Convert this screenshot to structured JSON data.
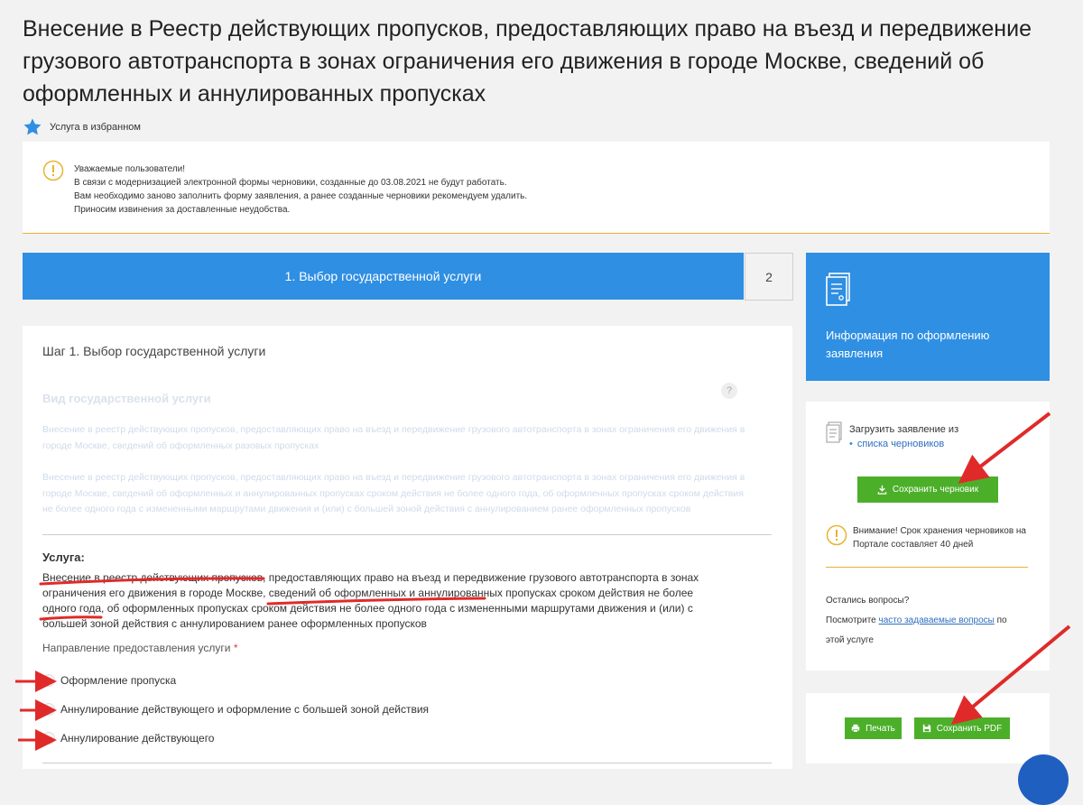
{
  "title": "Внесение в Реестр действующих пропусков, предоставляющих право на въезд и передвижение грузового автотранспорта в зонах ограничения его движения в городе Москве, сведений об оформленных и аннулированных пропусках",
  "favorite_label": "Услуга в избранном",
  "notice": {
    "line1": "Уважаемые пользователи!",
    "line2": "В связи с модернизацией электронной формы черновики, созданные до 03.08.2021 не будут работать.",
    "line3": "Вам необходимо заново заполнить форму заявления, а ранее созданные черновики рекомендуем удалить.",
    "line4": "Приносим извинения за доставленные неудобства."
  },
  "steps": {
    "active": "1. Выбор государственной услуги",
    "next": "2"
  },
  "info_panel": {
    "label": "Информация по оформлению заявления"
  },
  "form": {
    "heading": "Шаг 1. Выбор государственной услуги",
    "service_type_label": "Вид государственной услуги",
    "help": "?",
    "option1": "Внесение в реестр действующих пропусков, предоставляющих право на въезд и передвижение грузового автотранспорта в зонах ограничения его движения в городе Москве, сведений об оформленных разовых пропусках",
    "option2": "Внесение в реестр действующих пропусков, предоставляющих право на въезд и передвижение грузового автотранспорта в зонах ограничения его движения в городе Москве, сведений об оформленных и аннулированных пропусках сроком действия не более одного года, об оформленных пропусках сроком действия не более одного года с измененными маршрутами движения и (или) с большей зоной действия с аннулированием ранее оформленных пропусков",
    "service_label": "Услуга:",
    "service_text": "Внесение в реестр действующих пропусков, предоставляющих право на въезд и передвижение грузового автотранспорта в зонах ограничения его движения в городе Москве, сведений об оформленных и аннулированных пропусках сроком действия не более одного года, об оформленных пропусках сроком действия не более одного года с измененными маршрутами движения и (или) с большей зоной действия с аннулированием ранее оформленных пропусков",
    "direction_label": "Направление предоставления услуги",
    "required_mark": "*",
    "radios": [
      "Оформление пропуска",
      "Аннулирование действующего и оформление с большей зоной действия",
      "Аннулирование действующего"
    ]
  },
  "drafts": {
    "load_text": "Загрузить заявление из",
    "load_link": "списка черновиков",
    "save_button": "Сохранить черновик",
    "warning": "Внимание! Срок хранения черновиков на Портале составляет 40 дней"
  },
  "help_block": {
    "line1": "Остались вопросы?",
    "prefix": "Посмотрите",
    "faq_link": "часто задаваемые вопросы",
    "suffix": "по",
    "line3": "этой услуге"
  },
  "actions": {
    "print": "Печать",
    "save_pdf": "Сохранить PDF"
  },
  "colors": {
    "primary": "#2f8fe3",
    "green": "#4caf2a",
    "warning": "#e8b330",
    "annotation_red": "#e02a2a"
  }
}
